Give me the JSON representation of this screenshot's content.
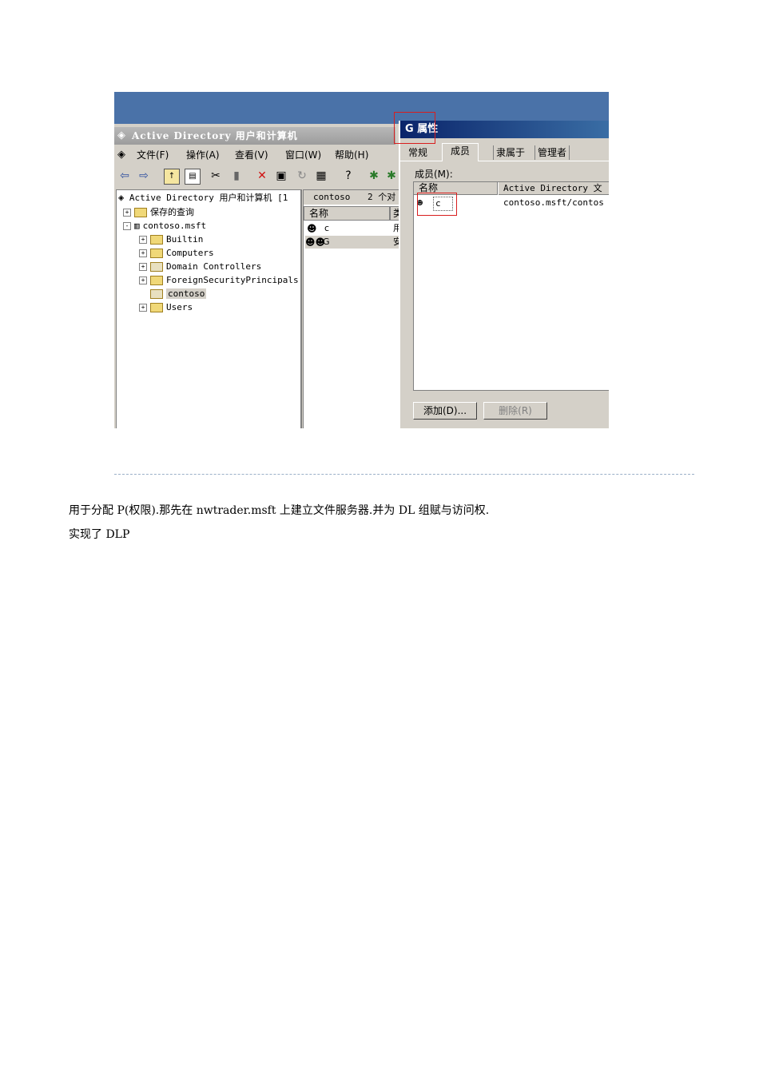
{
  "screenshot": {
    "mmc": {
      "title": "Active Directory 用户和计算机",
      "menu": [
        "文件(F)",
        "操作(A)",
        "查看(V)",
        "窗口(W)",
        "帮助(H)"
      ],
      "tree_root": "Active Directory 用户和计算机 [1",
      "tree": [
        {
          "label": "保存的查询",
          "expander": "+"
        },
        {
          "label": "contoso.msft",
          "expander": "-"
        },
        {
          "label": "Builtin",
          "expander": "+"
        },
        {
          "label": "Computers",
          "expander": "+"
        },
        {
          "label": "Domain Controllers",
          "expander": "+"
        },
        {
          "label": "ForeignSecurityPrincipals",
          "expander": "+"
        },
        {
          "label": "contoso",
          "expander": ""
        },
        {
          "label": "Users",
          "expander": "+"
        }
      ],
      "list_header_name": "contoso",
      "list_header_count": "2 个对",
      "list_col_name": "名称",
      "list_col_type": "类",
      "list_rows": [
        {
          "name": "c",
          "type": "用"
        },
        {
          "name": "G",
          "type": "安"
        }
      ]
    },
    "dialog": {
      "title": "G 属性",
      "tabs": [
        "常规",
        "成员",
        "隶属于",
        "管理者"
      ],
      "members_label": "成员(M):",
      "col_name": "名称",
      "col_folder": "Active Directory 文",
      "member_name": "c",
      "member_path": "contoso.msft/contos",
      "add_button": "添加(D)...",
      "remove_button": "删除(R)"
    }
  },
  "text": {
    "line1": "用于分配 P(权限).那先在 nwtrader.msft 上建立文件服务器.并为 DL 组赋与访问权.",
    "line2": "实现了 DLP"
  }
}
